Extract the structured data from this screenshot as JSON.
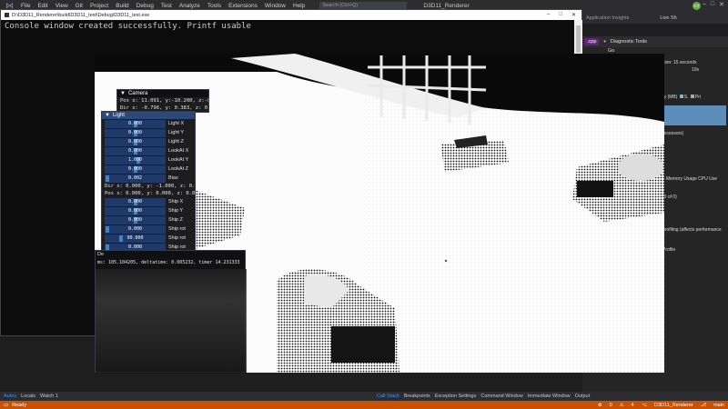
{
  "menubar": {
    "items": [
      "File",
      "Edit",
      "View",
      "Git",
      "Project",
      "Build",
      "Debug",
      "Test",
      "Analyze",
      "Tools",
      "Extensions",
      "Window",
      "Help"
    ],
    "search_placeholder": "Search (Ctrl+Q)",
    "app_title": "D3D11_Renderer",
    "avatar": "CT"
  },
  "toolbar2": {
    "app_insights": "Application Insights",
    "live_share": "Live Sh"
  },
  "diagnostics": {
    "tab_cpp": ".cpp",
    "title": "Diagnostic Tools",
    "go": "Go",
    "session": "sion: 15 seconds",
    "time_mark": "10s",
    "memory": "ry (MB)",
    "legend_s": "S.",
    "legend_pri": "Pri",
    "processors": "rocessors)",
    "tabs": "s  Memory Usage  CPU Use",
    "events": "(0 of 0)",
    "profiling": "profiling (affects performance",
    "profile": "Profile"
  },
  "console": {
    "title": "D:\\D3D11_Renderer\\build\\D3D11_test\\Debug\\D3D11_test.exe",
    "text": "Console window created successfully. Printf usable"
  },
  "camera": {
    "title": "Camera",
    "pos": "Pos x:  11.091, y:-10.200, z:-8(",
    "dir": "Dir x: -0.796, y: 0.383, z: 0.55"
  },
  "light": {
    "title": "Light",
    "sliders_a": [
      {
        "value": "0.000",
        "label": "Light X",
        "pos": 0.5
      },
      {
        "value": "0.000",
        "label": "Light Y",
        "pos": 0.5
      },
      {
        "value": "0.000",
        "label": "Light Z",
        "pos": 0.5
      },
      {
        "value": "0.000",
        "label": "LookAt X",
        "pos": 0.5
      },
      {
        "value": "1.000",
        "label": "LookAt Y",
        "pos": 0.55
      },
      {
        "value": "0.000",
        "label": "LookAt Z",
        "pos": 0.5
      },
      {
        "value": "0.002",
        "label": "Bias",
        "pos": 0.02
      }
    ],
    "dir_line": "Dir x: 0.000, y: -1.000, z: 0.00",
    "pos_line": "Pos x: 0.000, y: 0.000, z: 0.00",
    "sliders_b": [
      {
        "value": "0.000",
        "label": "Ship X",
        "pos": 0.5
      },
      {
        "value": "0.000",
        "label": "Ship Y",
        "pos": 0.5
      },
      {
        "value": "0.000",
        "label": "Ship Z",
        "pos": 0.5
      },
      {
        "value": "0.000",
        "label": "Ship rot",
        "pos": 0.02
      },
      {
        "value": "90.000",
        "label": "Ship rot",
        "pos": 0.25
      },
      {
        "value": "0.000",
        "label": "Ship rot",
        "pos": 0.02
      }
    ]
  },
  "debug": {
    "title": "De",
    "fps_line": "ms: 105.104205, deltatime: 0.005232, timer 14.231333"
  },
  "bottom_left_tabs": [
    "Autos",
    "Locals",
    "Watch 1"
  ],
  "bottom_right_tabs": [
    "Call Stack",
    "Breakpoints",
    "Exception Settings",
    "Command Window",
    "Immediate Window",
    "Output"
  ],
  "status": {
    "ready": "Ready",
    "errors": "0",
    "warnings": "4",
    "project": "D3D11_Renderer",
    "branch": "main"
  },
  "colors": {
    "vs_bg": "#1e1e1e",
    "status": "#ca5100",
    "imgui_title": "#294a7a",
    "imgui_slider": "#1f3a66",
    "imgui_grab": "#3d85c6"
  }
}
